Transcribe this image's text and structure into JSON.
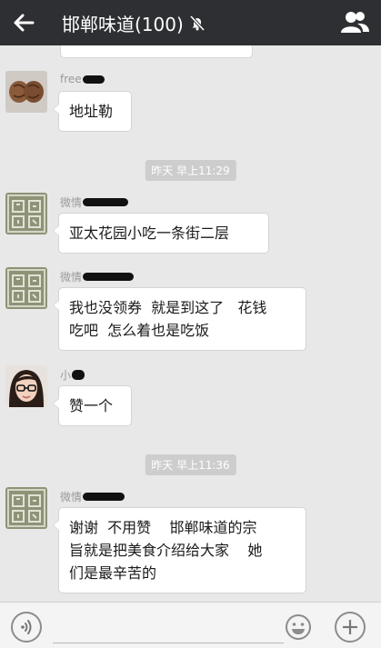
{
  "header": {
    "title": "邯郸味道(100)",
    "back_icon": "arrow-left-icon",
    "mute_icon": "bell-muted-icon",
    "members_icon": "group-members-icon",
    "background": "#2d2f33"
  },
  "messages": [
    {
      "kind": "message",
      "sender": "free",
      "avatar": "walnut-photo",
      "text": "地址勒"
    },
    {
      "kind": "time",
      "text": "昨天 早上11:29"
    },
    {
      "kind": "message",
      "sender": "微情",
      "avatar": "seal-stamp",
      "text": "亚太花园小吃一条街二层"
    },
    {
      "kind": "message",
      "sender": "微情",
      "avatar": "seal-stamp",
      "text": "我也没领券  就是到这了   花钱\n吃吧  怎么着也是吃饭"
    },
    {
      "kind": "message",
      "sender": "小",
      "avatar": "girl-with-glasses",
      "text": "赞一个"
    },
    {
      "kind": "time",
      "text": "昨天 早上11:36"
    },
    {
      "kind": "message",
      "sender": "微情",
      "avatar": "seal-stamp",
      "text": "谢谢  不用赞    邯郸味道的宗\n旨就是把美食介绍给大家    她\n们是最辛苦的"
    }
  ],
  "input_bar": {
    "voice_icon": "voice-icon",
    "emoji_icon": "emoji-icon",
    "plus_icon": "plus-icon",
    "placeholder": ""
  }
}
